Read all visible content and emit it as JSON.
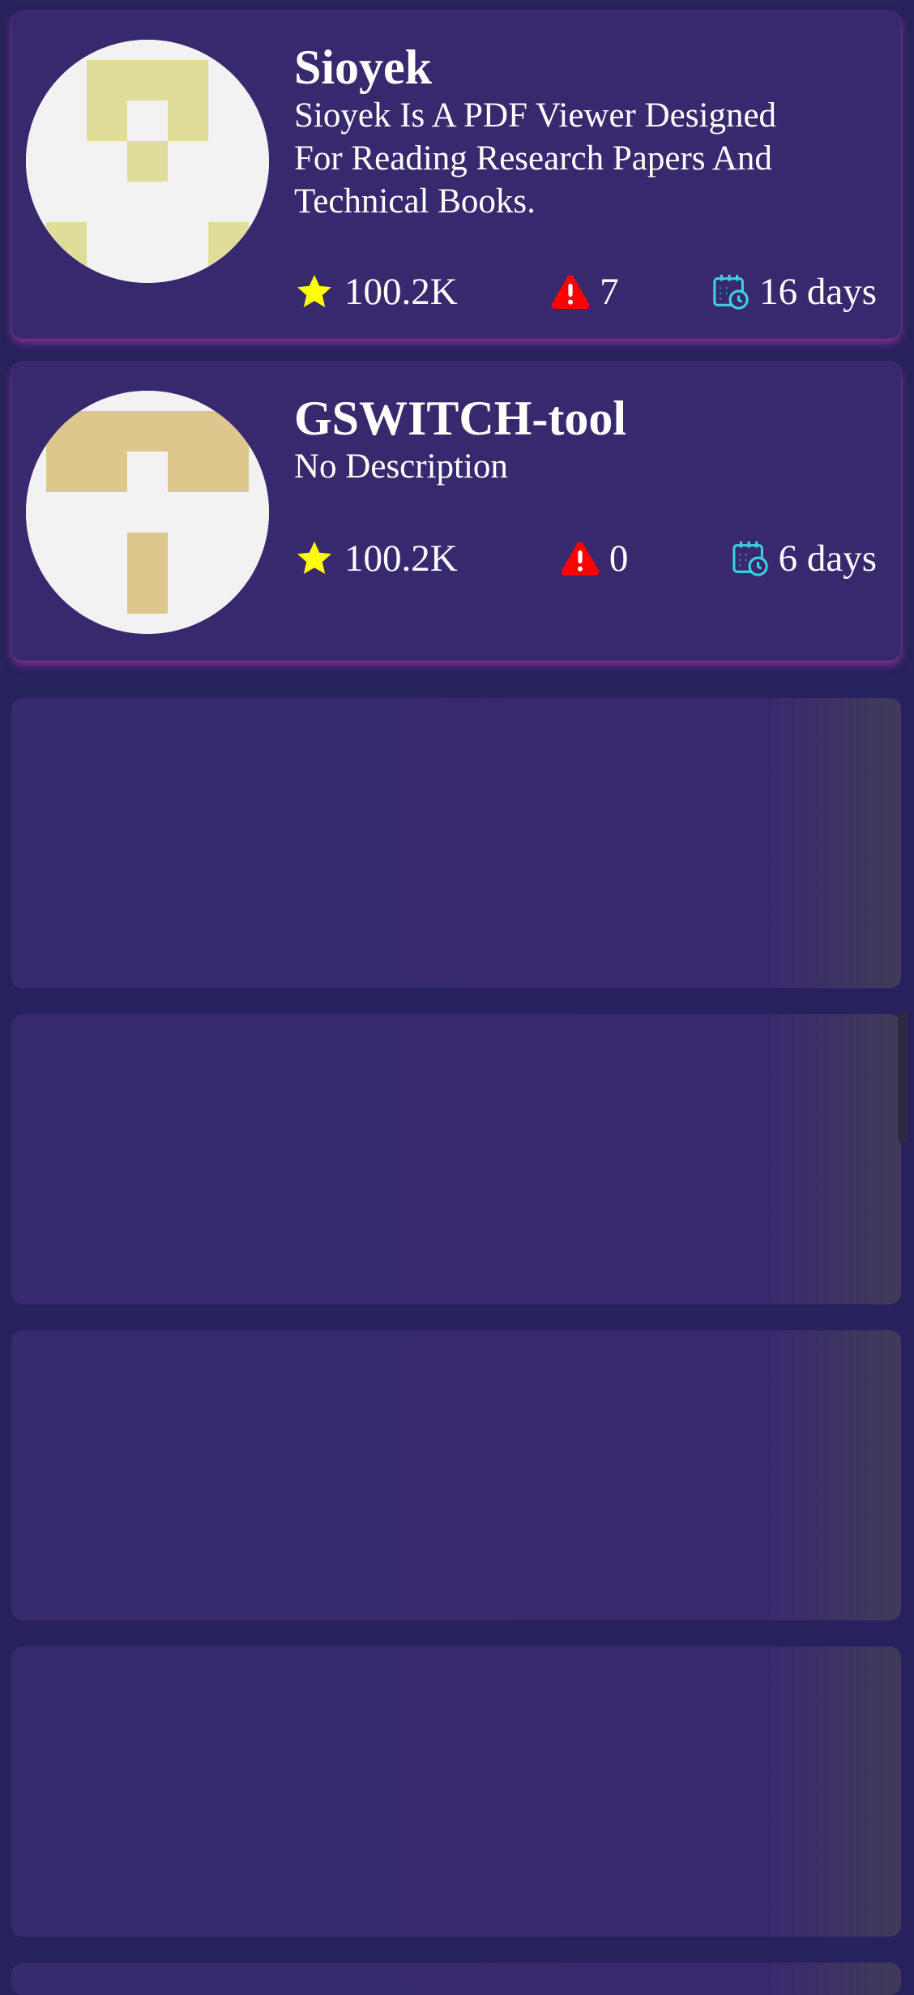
{
  "repos": [
    {
      "name": "Sioyek",
      "description_lines": [
        "Sioyek Is A PDF Viewer Designed",
        "For Reading Research Papers And",
        "Technical Books."
      ],
      "stars": "100.2K",
      "issues": "7",
      "updated": "16 days",
      "avatar_color": "#e0dc9a"
    },
    {
      "name": "GSWITCH-tool",
      "description_lines": [
        "No Description"
      ],
      "stars": "100.2K",
      "issues": "0",
      "updated": "6 days",
      "avatar_color": "#dec78d"
    }
  ],
  "icons": {
    "stars": "star-icon",
    "issues": "warning-icon",
    "updated": "calendar-clock-icon"
  },
  "colors": {
    "background": "#27215e",
    "card": "#38296e",
    "star": "#ffff00",
    "warning": "#ff0000",
    "calendar": "#3cd1e0"
  },
  "skeleton_card_count": 4
}
